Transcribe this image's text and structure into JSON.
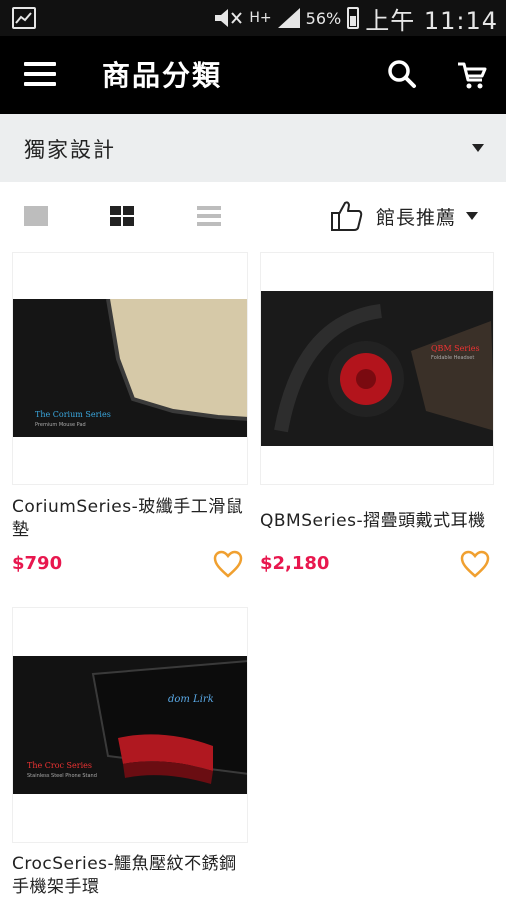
{
  "status_bar": {
    "battery_percent": "56%",
    "time": "上午 11:14",
    "network_label": "H+"
  },
  "app_bar": {
    "title": "商品分類"
  },
  "category_selector": {
    "selected": "獨家設計"
  },
  "sort_selector": {
    "selected": "館長推薦"
  },
  "colors": {
    "price": "#e8174e",
    "favorite_heart": "#f0a030",
    "app_bar": "#000000",
    "category_bar": "#eceeef"
  },
  "products": [
    {
      "name": "CoriumSeries-玻纖手工滑鼠墊",
      "price": "$790",
      "image_caption_title": "The Corium Series",
      "image_caption_sub": "Premium Mouse Pad"
    },
    {
      "name": "QBMSeries-摺疊頭戴式耳機",
      "price": "$2,180",
      "image_caption_title": "QBM Series",
      "image_caption_sub": "Foldable Headset"
    },
    {
      "name": "CrocSeries-鱷魚壓紋不銹鋼手機架手環",
      "price": "",
      "image_caption_title": "The Croc Series",
      "image_caption_sub": "Stainless Steel Phone Stand"
    }
  ]
}
